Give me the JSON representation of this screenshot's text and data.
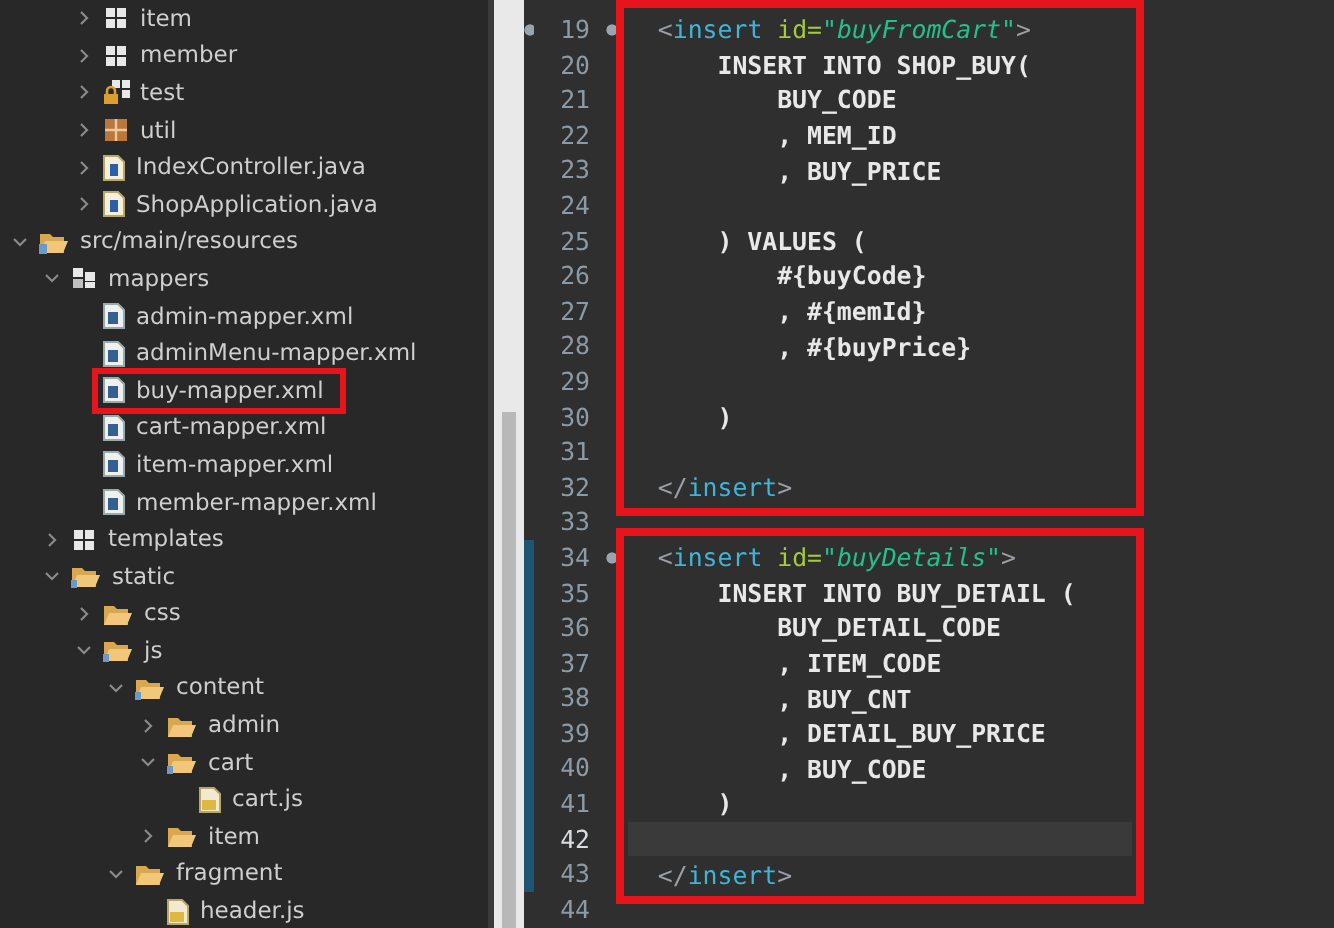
{
  "project_tree": [
    {
      "kind": "hidden",
      "children": [
        {
          "kind": "hidden",
          "children": [
            {
              "label": "item",
              "kind": "package",
              "expanded": false,
              "highlighted": false
            },
            {
              "label": "member",
              "kind": "package",
              "expanded": false,
              "highlighted": false
            },
            {
              "label": "test",
              "kind": "package-locked",
              "expanded": false,
              "highlighted": false
            },
            {
              "label": "util",
              "kind": "package-empty",
              "expanded": false,
              "highlighted": false
            },
            {
              "label": "IndexController.java",
              "kind": "java",
              "expanded": false,
              "highlighted": false
            },
            {
              "label": "ShopApplication.java",
              "kind": "java",
              "expanded": false,
              "highlighted": false
            }
          ]
        }
      ]
    },
    {
      "label": "src/main/resources",
      "kind": "source-folder",
      "expanded": true,
      "highlighted": false,
      "children": [
        {
          "label": "mappers",
          "kind": "package-folder",
          "expanded": true,
          "highlighted": false,
          "children": [
            {
              "label": "admin-mapper.xml",
              "kind": "xml",
              "highlighted": false
            },
            {
              "label": "adminMenu-mapper.xml",
              "kind": "xml",
              "highlighted": false
            },
            {
              "label": "buy-mapper.xml",
              "kind": "xml",
              "highlighted": true
            },
            {
              "label": "cart-mapper.xml",
              "kind": "xml",
              "highlighted": false
            },
            {
              "label": "item-mapper.xml",
              "kind": "xml",
              "highlighted": false
            },
            {
              "label": "member-mapper.xml",
              "kind": "xml",
              "highlighted": false
            }
          ]
        },
        {
          "label": "templates",
          "kind": "package",
          "expanded": false,
          "highlighted": false
        },
        {
          "label": "static",
          "kind": "shared-folder",
          "expanded": true,
          "highlighted": false,
          "children": [
            {
              "label": "css",
              "kind": "folder",
              "expanded": false,
              "highlighted": false
            },
            {
              "label": "js",
              "kind": "shared-folder",
              "expanded": true,
              "highlighted": false,
              "children": [
                {
                  "label": "content",
                  "kind": "shared-folder",
                  "expanded": true,
                  "highlighted": false,
                  "children": [
                    {
                      "label": "admin",
                      "kind": "folder",
                      "expanded": false,
                      "highlighted": false
                    },
                    {
                      "label": "cart",
                      "kind": "shared-folder",
                      "expanded": true,
                      "highlighted": false,
                      "children": [
                        {
                          "label": "cart.js",
                          "kind": "js",
                          "highlighted": false
                        }
                      ]
                    },
                    {
                      "label": "item",
                      "kind": "folder",
                      "expanded": false,
                      "highlighted": false
                    }
                  ]
                },
                {
                  "label": "fragment",
                  "kind": "folder",
                  "expanded": true,
                  "highlighted": false,
                  "children": [
                    {
                      "label": "header.js",
                      "kind": "js",
                      "highlighted": false
                    }
                  ]
                }
              ]
            }
          ]
        }
      ]
    }
  ],
  "editor": {
    "items": [
      {
        "kind": "annotation",
        "lines": [
          {
            "number": "19",
            "foldable": true,
            "changed": false,
            "current": false,
            "tokens": [
              {
                "kind": "punct",
                "text": "  <"
              },
              {
                "kind": "tag",
                "text": "insert"
              },
              {
                "kind": "attr",
                "text": " id="
              },
              {
                "kind": "value",
                "text": "\"buyFromCart\""
              },
              {
                "kind": "punct",
                "text": ">"
              }
            ]
          },
          {
            "number": "20",
            "foldable": false,
            "changed": false,
            "current": false,
            "tokens": [
              {
                "kind": "sql",
                "text": "      INSERT INTO SHOP_BUY("
              }
            ]
          },
          {
            "number": "21",
            "foldable": false,
            "changed": false,
            "current": false,
            "tokens": [
              {
                "kind": "sql",
                "text": "          BUY_CODE"
              }
            ]
          },
          {
            "number": "22",
            "foldable": false,
            "changed": false,
            "current": false,
            "tokens": [
              {
                "kind": "sql",
                "text": "          , MEM_ID"
              }
            ]
          },
          {
            "number": "23",
            "foldable": false,
            "changed": false,
            "current": false,
            "tokens": [
              {
                "kind": "sql",
                "text": "          , BUY_PRICE"
              }
            ]
          },
          {
            "number": "24",
            "foldable": false,
            "changed": false,
            "current": false
          },
          {
            "number": "25",
            "foldable": false,
            "changed": false,
            "current": false,
            "tokens": [
              {
                "kind": "sql",
                "text": "      ) VALUES ("
              }
            ]
          },
          {
            "number": "26",
            "foldable": false,
            "changed": false,
            "current": false,
            "tokens": [
              {
                "kind": "sql",
                "text": "          #{buyCode}"
              }
            ]
          },
          {
            "number": "27",
            "foldable": false,
            "changed": false,
            "current": false,
            "tokens": [
              {
                "kind": "sql",
                "text": "          , #{memId}"
              }
            ]
          },
          {
            "number": "28",
            "foldable": false,
            "changed": false,
            "current": false,
            "tokens": [
              {
                "kind": "sql",
                "text": "          , #{buyPrice}"
              }
            ]
          },
          {
            "number": "29",
            "foldable": false,
            "changed": false,
            "current": false
          },
          {
            "number": "30",
            "foldable": false,
            "changed": false,
            "current": false,
            "tokens": [
              {
                "kind": "sql",
                "text": "      )"
              }
            ]
          },
          {
            "number": "31",
            "foldable": false,
            "changed": false,
            "current": false
          },
          {
            "number": "32",
            "foldable": false,
            "changed": false,
            "current": false,
            "tokens": [
              {
                "kind": "punct",
                "text": "  </"
              },
              {
                "kind": "tag",
                "text": "insert"
              },
              {
                "kind": "punct",
                "text": ">"
              }
            ]
          }
        ]
      },
      {
        "kind": "line",
        "number": "33",
        "foldable": false,
        "changed": false,
        "current": false
      },
      {
        "kind": "annotation",
        "lines": [
          {
            "number": "34",
            "foldable": true,
            "changed": true,
            "current": false,
            "tokens": [
              {
                "kind": "punct",
                "text": "  <"
              },
              {
                "kind": "tag",
                "text": "insert"
              },
              {
                "kind": "attr",
                "text": " id="
              },
              {
                "kind": "value",
                "text": "\"buyDetails\""
              },
              {
                "kind": "punct",
                "text": ">"
              }
            ]
          },
          {
            "number": "35",
            "foldable": false,
            "changed": true,
            "current": false,
            "tokens": [
              {
                "kind": "sql",
                "text": "      INSERT INTO BUY_DETAIL ("
              }
            ]
          },
          {
            "number": "36",
            "foldable": false,
            "changed": true,
            "current": false,
            "tokens": [
              {
                "kind": "sql",
                "text": "          BUY_DETAIL_CODE"
              }
            ]
          },
          {
            "number": "37",
            "foldable": false,
            "changed": true,
            "current": false,
            "tokens": [
              {
                "kind": "sql",
                "text": "          , ITEM_CODE"
              }
            ]
          },
          {
            "number": "38",
            "foldable": false,
            "changed": true,
            "current": false,
            "tokens": [
              {
                "kind": "sql",
                "text": "          , BUY_CNT"
              }
            ]
          },
          {
            "number": "39",
            "foldable": false,
            "changed": true,
            "current": false,
            "tokens": [
              {
                "kind": "sql",
                "text": "          , DETAIL_BUY_PRICE"
              }
            ]
          },
          {
            "number": "40",
            "foldable": false,
            "changed": true,
            "current": false,
            "tokens": [
              {
                "kind": "sql",
                "text": "          , BUY_CODE"
              }
            ]
          },
          {
            "number": "41",
            "foldable": false,
            "changed": true,
            "current": false,
            "tokens": [
              {
                "kind": "sql",
                "text": "      )"
              }
            ]
          },
          {
            "number": "42",
            "foldable": false,
            "changed": true,
            "current": true
          },
          {
            "number": "43",
            "foldable": false,
            "changed": true,
            "current": false,
            "tokens": [
              {
                "kind": "punct",
                "text": "  </"
              },
              {
                "kind": "tag",
                "text": "insert"
              },
              {
                "kind": "punct",
                "text": ">"
              }
            ]
          }
        ]
      },
      {
        "kind": "line",
        "number": "44",
        "foldable": false,
        "changed": false,
        "current": false
      }
    ]
  }
}
